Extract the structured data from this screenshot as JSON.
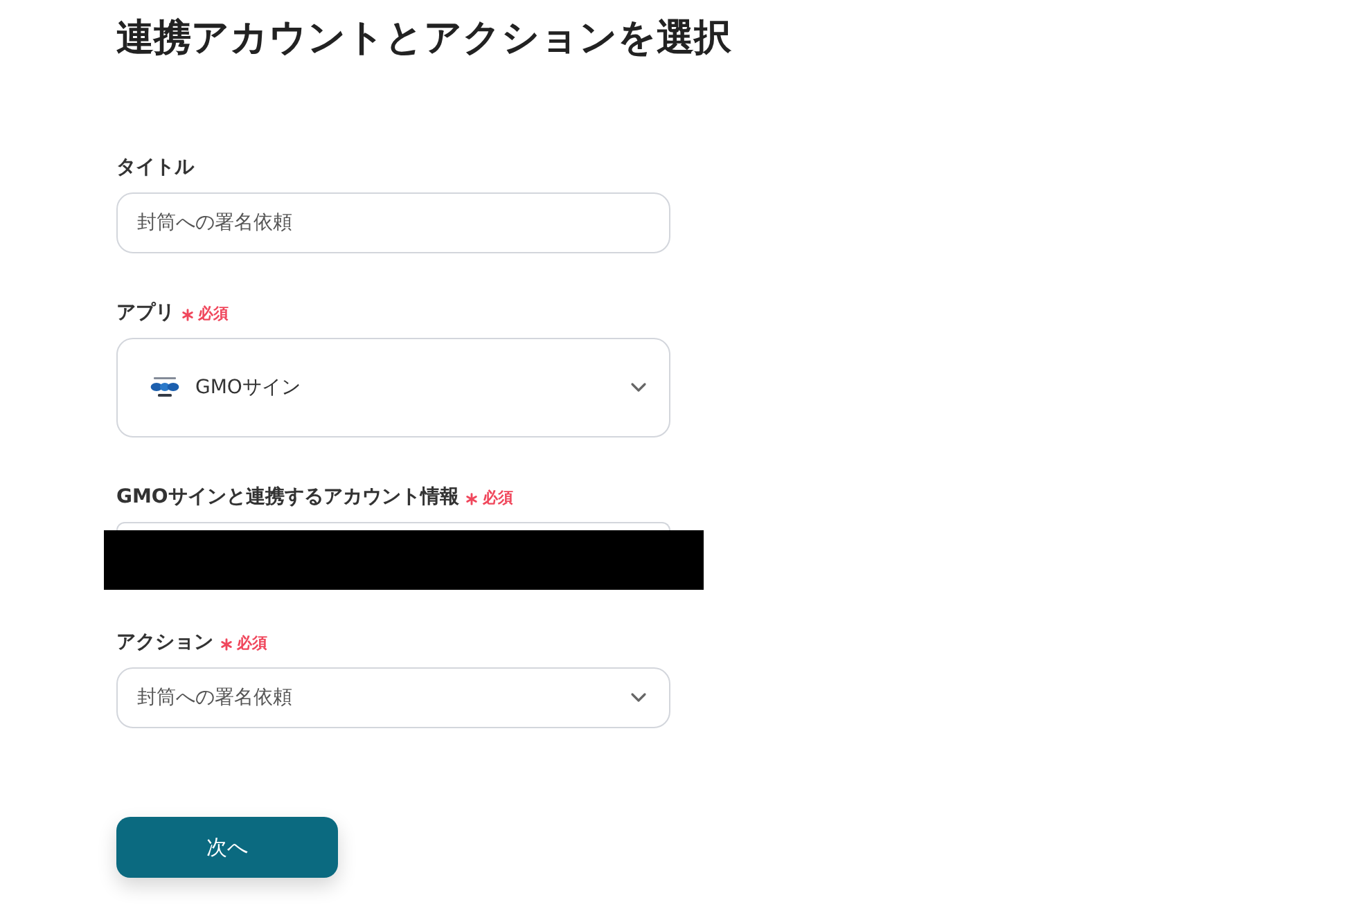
{
  "page": {
    "title": "連携アカウントとアクションを選択"
  },
  "fields": [
    {
      "kind": "text",
      "label": "タイトル",
      "required": false,
      "value": "封筒への署名依頼"
    },
    {
      "kind": "app-select",
      "label": "アプリ",
      "required": true,
      "required_text": "必須",
      "value": "GMOサイン"
    },
    {
      "kind": "account",
      "label": "GMOサインと連携するアカウント情報",
      "required": true,
      "required_text": "必須",
      "redacted": true
    },
    {
      "kind": "select",
      "label": "アクション",
      "required": true,
      "required_text": "必須",
      "value": "封筒への署名依頼"
    }
  ],
  "next_button": {
    "label": "次へ"
  }
}
